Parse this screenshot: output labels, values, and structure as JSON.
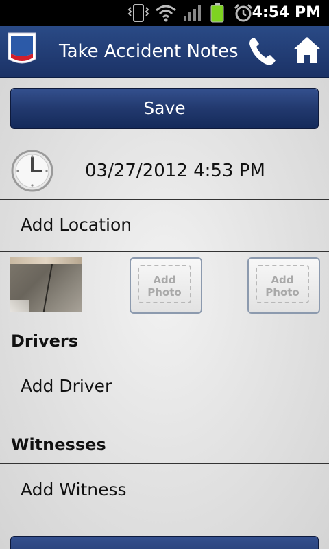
{
  "status_bar": {
    "time": "4:54 PM"
  },
  "app_bar": {
    "title": "Take Accident Notes"
  },
  "form": {
    "save_label": "Save",
    "datetime": "03/27/2012 4:53 PM",
    "add_location": "Add Location",
    "photos": [
      {
        "label_line1": "Add",
        "label_line2": "Photo"
      },
      {
        "label_line1": "Add",
        "label_line2": "Photo"
      }
    ],
    "drivers_header": "Drivers",
    "add_driver": "Add Driver",
    "witnesses_header": "Witnesses",
    "add_witness": "Add Witness"
  },
  "colors": {
    "app_bar": "#1b3266",
    "button": "#22396e",
    "battery": "#7ed321"
  },
  "icons": [
    "vibrate-icon",
    "wifi-icon",
    "signal-icon",
    "battery-icon",
    "alarm-icon",
    "app-logo-icon",
    "phone-icon",
    "home-icon",
    "clock-icon"
  ]
}
